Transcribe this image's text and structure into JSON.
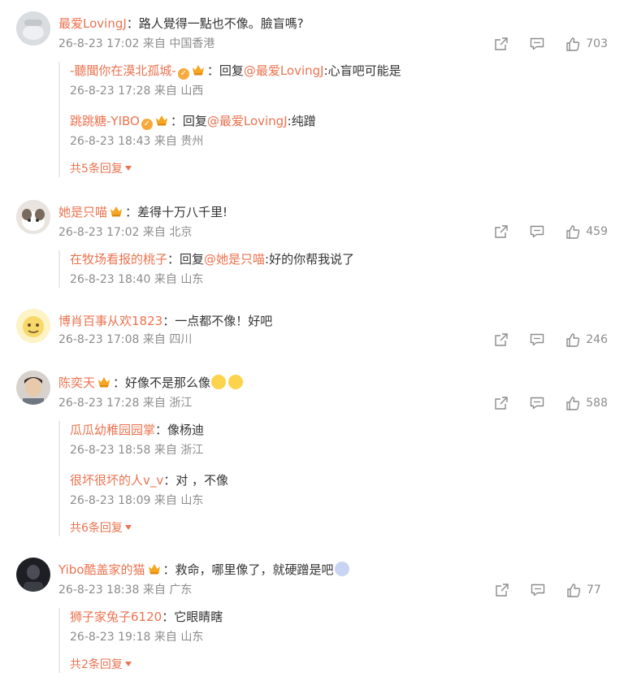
{
  "colors": {
    "username": "#eb7350",
    "meta": "#8c8c8c",
    "thread_line": "#eaeaea"
  },
  "comments": [
    {
      "user": "最爱LovingJ",
      "text": "：路人覺得一點也不像。臉盲嗎?",
      "time": "26-8-23 17:02",
      "source": "来自 中国香港",
      "likes": "703",
      "replies": [
        {
          "user": "-聽聞你在漠北孤城-",
          "reply_to_prefix": "：回复",
          "reply_to": "@最爱LovingJ",
          "text": ":心盲吧可能是",
          "time": "26-8-23 17:28",
          "source": "来自 山西"
        },
        {
          "user": "跳跳糖-YIBO",
          "reply_to_prefix": "：回复",
          "reply_to": "@最爱LovingJ",
          "text": ":纯蹭",
          "time": "26-8-23 18:43",
          "source": "来自 贵州"
        }
      ],
      "more": "共5条回复"
    },
    {
      "user": "她是只喵",
      "text": "：差得十万八千里!",
      "time": "26-8-23 17:02",
      "source": "来自 北京",
      "likes": "459",
      "replies": [
        {
          "user": "在牧场看报的桃子",
          "reply_to_prefix": "：回复",
          "reply_to": "@她是只喵",
          "text": ":好的你帮我说了",
          "time": "26-8-23 18:40",
          "source": "来自 山东"
        }
      ]
    },
    {
      "user": "博肖百事从欢1823",
      "text": "：一点都不像！好吧",
      "time": "26-8-23 17:08",
      "source": "来自 四川",
      "likes": "246"
    },
    {
      "user": "陈奕天",
      "text": "：好像不是那么像",
      "time": "26-8-23 17:28",
      "source": "来自 浙江",
      "likes": "588",
      "replies": [
        {
          "user": "瓜瓜幼稚园园掌",
          "text": "：像杨迪",
          "time": "26-8-23 18:58",
          "source": "来自 浙江"
        },
        {
          "user": "很坏很坏的人v_v",
          "text": "：对 ，不像",
          "time": "26-8-23 18:09",
          "source": "来自 山东"
        }
      ],
      "more": "共6条回复"
    },
    {
      "user": "Yibo酷盖家的猫",
      "text": "：救命，哪里像了，就硬蹭是吧",
      "time": "26-8-23 18:38",
      "source": "来自 广东",
      "likes": "77",
      "replies": [
        {
          "user": "狮子家兔子6120",
          "text": "：它眼睛瞎",
          "time": "26-8-23 19:18",
          "source": "来自 山东"
        }
      ],
      "more": "共2条回复"
    }
  ]
}
